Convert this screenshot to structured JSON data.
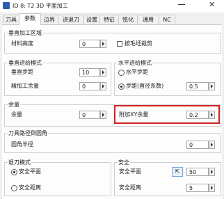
{
  "window": {
    "title": "ID 8: T2 3D 平面加工"
  },
  "tabs": [
    "刀具",
    "参数",
    "边界",
    "进退刀",
    "设置",
    "特征",
    "铣化",
    "通用",
    "NC"
  ],
  "vertical_area": {
    "legend": "垂直加工区域",
    "material_height_label": "材料高度",
    "material_height_value": "0",
    "face_crop_label": "按毛坯裁剪"
  },
  "vertical_feed": {
    "legend": "垂直进给模式",
    "step_label": "垂直步距",
    "step_value": "10",
    "finish_allow_label": "精加工余量",
    "finish_allow_value": "0"
  },
  "horizontal_feed": {
    "legend": "水平进给模式",
    "h_step_label": "水平步距",
    "step_coef_label": "步距(直径系数)",
    "step_coef_value": "0.5"
  },
  "allowance": {
    "legend": "余量",
    "allow_label": "余量",
    "allow_value": "0",
    "xy_label": "附加XY余量",
    "xy_value": "0.2"
  },
  "tool_path_round": {
    "legend": "刀具路径倒圆角",
    "radius_label": "圆角半径",
    "radius_value": "0"
  },
  "retract": {
    "legend": "退刀模式",
    "safe_plane_label": "安全平面",
    "safe_dist_label": "安全距离"
  },
  "safety": {
    "legend": "安全",
    "safe_plane_label": "安全平面",
    "safe_plane_value": "50",
    "safe_dist_label": "安全距离",
    "safe_dist_value": "5"
  },
  "colors": {
    "highlight": "#d32020"
  }
}
